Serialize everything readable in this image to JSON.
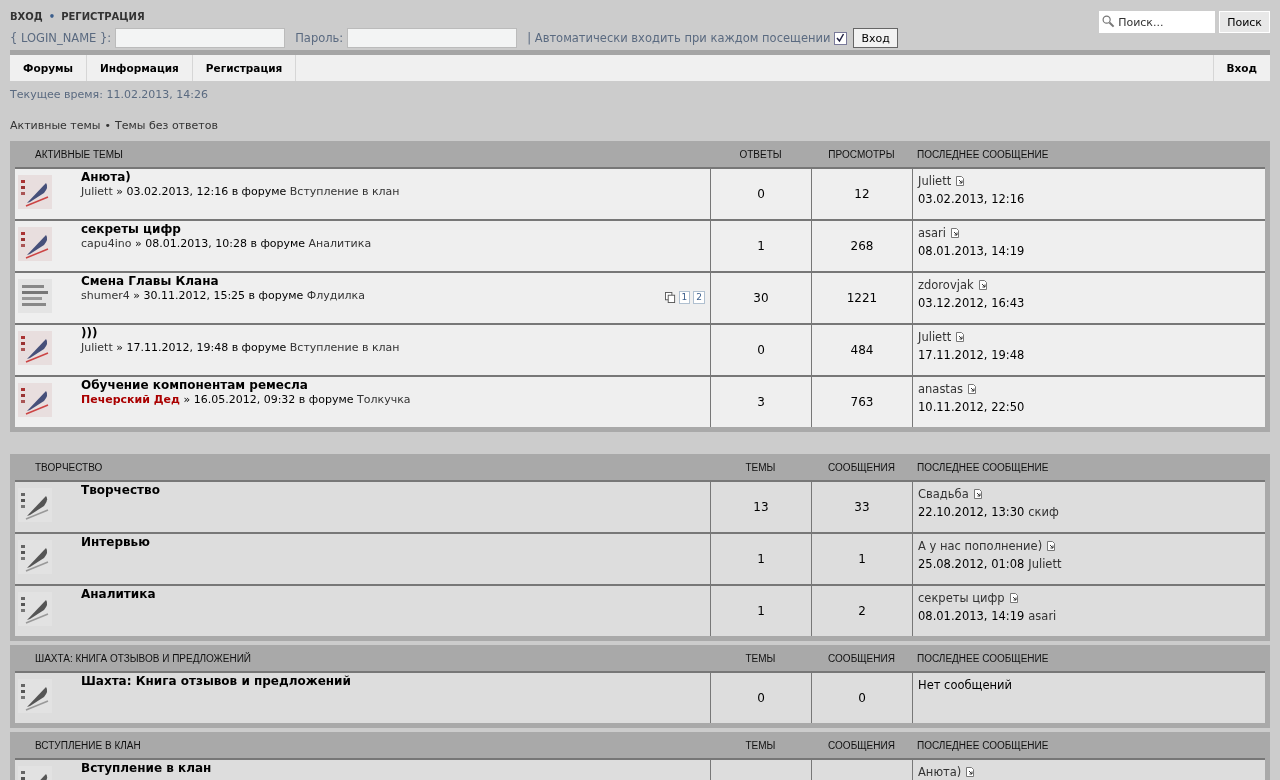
{
  "header_links": {
    "items": [
      "ВХОД",
      "РЕГИСТРАЦИЯ"
    ],
    "separator": "•"
  },
  "login": {
    "username_label": "{ LOGIN_NAME }:",
    "password_label": "Пароль:",
    "remember_label": "| Автоматически входить при каждом посещении",
    "remember_checked": true,
    "submit": "Вход"
  },
  "search": {
    "placeholder": "Поиск...",
    "button": "Поиск"
  },
  "nav": {
    "items": [
      "Форумы",
      "Информация",
      "Регистрация"
    ],
    "right": "Вход"
  },
  "current_time": "Текущее время: 11.02.2013, 14:26",
  "quick_links": {
    "items": [
      "Активные темы",
      "Темы без ответов"
    ],
    "separator": "•"
  },
  "sections": [
    {
      "kind": "topics",
      "title": "АКТИВНЫЕ ТЕМЫ",
      "columns": [
        "ОТВЕТЫ",
        "ПРОСМОТРЫ",
        "ПОСЛЕДНЕЕ СООБЩЕНИЕ"
      ],
      "rows": [
        {
          "title": "Анюта)",
          "author": "Juliett",
          "author_highlight": false,
          "meta": "» 03.02.2013, 12:16 в форуме",
          "forum": "Вступление в клан",
          "hot": false,
          "pages": [],
          "replies": "0",
          "views": "12",
          "last_author": "Juliett",
          "last_time": "03.02.2013, 12:16"
        },
        {
          "title": "секреты цифр",
          "author": "capu4ino",
          "author_highlight": false,
          "meta": "» 08.01.2013, 10:28 в форуме",
          "forum": "Аналитика",
          "hot": false,
          "pages": [],
          "replies": "1",
          "views": "268",
          "last_author": "asari",
          "last_time": "08.01.2013, 14:19"
        },
        {
          "title": "Смена Главы Клана",
          "author": "shumer4",
          "author_highlight": false,
          "meta": "» 30.11.2012, 15:25 в форуме",
          "forum": "Флудилка",
          "hot": true,
          "pages": [
            "1",
            "2"
          ],
          "replies": "30",
          "views": "1221",
          "last_author": "zdorovjak",
          "last_time": "03.12.2012, 16:43"
        },
        {
          "title": ")))",
          "author": "Juliett",
          "author_highlight": false,
          "meta": "» 17.11.2012, 19:48 в форуме",
          "forum": "Вступление в клан",
          "hot": false,
          "pages": [],
          "replies": "0",
          "views": "484",
          "last_author": "Juliett",
          "last_time": "17.11.2012, 19:48"
        },
        {
          "title": "Обучение компонентам ремесла",
          "author": "Печерский Дед",
          "author_highlight": true,
          "meta": "» 16.05.2012, 09:32 в форуме",
          "forum": "Толкучка",
          "hot": false,
          "pages": [],
          "replies": "3",
          "views": "763",
          "last_author": "anastas",
          "last_time": "10.11.2012, 22:50"
        }
      ]
    },
    {
      "kind": "forums",
      "title": "ТВОРЧЕСТВО",
      "columns": [
        "ТЕМЫ",
        "СООБЩЕНИЯ",
        "ПОСЛЕДНЕЕ СООБЩЕНИЕ"
      ],
      "rows": [
        {
          "title": "Творчество",
          "topics": "13",
          "posts": "33",
          "last_title": "Свадьба",
          "last_time": "22.10.2012, 13:30",
          "last_author": "скиф"
        },
        {
          "title": "Интервью",
          "topics": "1",
          "posts": "1",
          "last_title": "А у нас пополнение)",
          "last_time": "25.08.2012, 01:08",
          "last_author": "Juliett"
        },
        {
          "title": "Аналитика",
          "topics": "1",
          "posts": "2",
          "last_title": "секреты цифр",
          "last_time": "08.01.2013, 14:19",
          "last_author": "asari"
        }
      ]
    },
    {
      "kind": "forums",
      "title": "ШАХТА: КНИГА ОТЗЫВОВ И ПРЕДЛОЖЕНИЙ",
      "columns": [
        "ТЕМЫ",
        "СООБЩЕНИЯ",
        "ПОСЛЕДНЕЕ СООБЩЕНИЕ"
      ],
      "rows": [
        {
          "title": "Шахта: Книга отзывов и предложений",
          "topics": "0",
          "posts": "0",
          "empty_text": "Нет сообщений"
        }
      ]
    },
    {
      "kind": "forums",
      "title": "ВСТУПЛЕНИЕ В КЛАН",
      "columns": [
        "ТЕМЫ",
        "СООБЩЕНИЯ",
        "ПОСЛЕДНЕЕ СООБЩЕНИЕ"
      ],
      "rows": [
        {
          "title": "Вступление в клан",
          "last_title": "Анюта)"
        }
      ]
    }
  ]
}
